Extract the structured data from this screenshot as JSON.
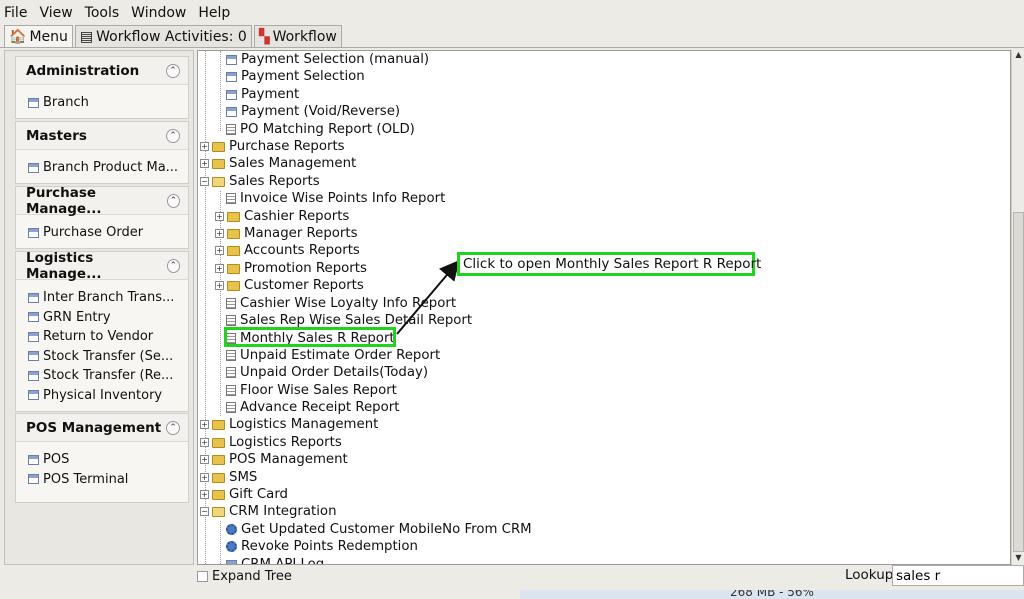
{
  "menubar": {
    "items": [
      "File",
      "View",
      "Tools",
      "Window",
      "Help"
    ]
  },
  "tabs": [
    {
      "label": "Menu",
      "icon": "home-icon"
    },
    {
      "label": "Workflow Activities: 0",
      "icon": "list-icon"
    },
    {
      "label": "Workflow",
      "icon": "workflow-icon"
    }
  ],
  "left_panel": {
    "sections": [
      {
        "title": "Administration",
        "items": [
          "Branch"
        ]
      },
      {
        "title": "Masters",
        "items": [
          "Branch Product Ma..."
        ]
      },
      {
        "title": "Purchase Manage...",
        "items": [
          "Purchase Order"
        ]
      },
      {
        "title": "Logistics Manage...",
        "items": [
          "Inter Branch Trans...",
          "GRN Entry",
          "Return to Vendor",
          "Stock Transfer (Se...",
          "Stock Transfer (Re...",
          "Physical Inventory"
        ]
      },
      {
        "title": "POS Management",
        "items": [
          "POS",
          "POS Terminal"
        ]
      }
    ]
  },
  "tree": {
    "rows": [
      "Payment Selection (manual)",
      "Payment Selection",
      "Payment",
      "Payment (Void/Reverse)",
      "PO Matching Report (OLD)",
      "Purchase Reports",
      "Sales Management",
      "Sales Reports",
      "Invoice Wise Points Info Report",
      "Cashier Reports",
      "Manager Reports",
      "Accounts Reports",
      "Promotion Reports",
      "Customer Reports",
      "Cashier Wise Loyalty Info Report",
      "Sales Rep Wise Sales Detail Report",
      "Monthly Sales R Report",
      "Unpaid Estimate Order Report",
      "Unpaid Order Details(Today)",
      "Floor Wise Sales Report",
      "Advance Receipt Report",
      "Logistics Management",
      "Logistics Reports",
      "POS Management",
      "SMS",
      "Gift Card",
      "CRM Integration",
      "Get Updated Customer MobileNo From CRM",
      "Revoke Points Redemption",
      "CRM API Log"
    ]
  },
  "callout": "Click to open Monthly Sales Report R Report",
  "bottom": {
    "expand_tree": "Expand Tree",
    "lookup_label": "Lookup",
    "lookup_value": "sales r"
  },
  "status": "268 MB - 56%",
  "colors": {
    "highlight": "#22d31e"
  }
}
